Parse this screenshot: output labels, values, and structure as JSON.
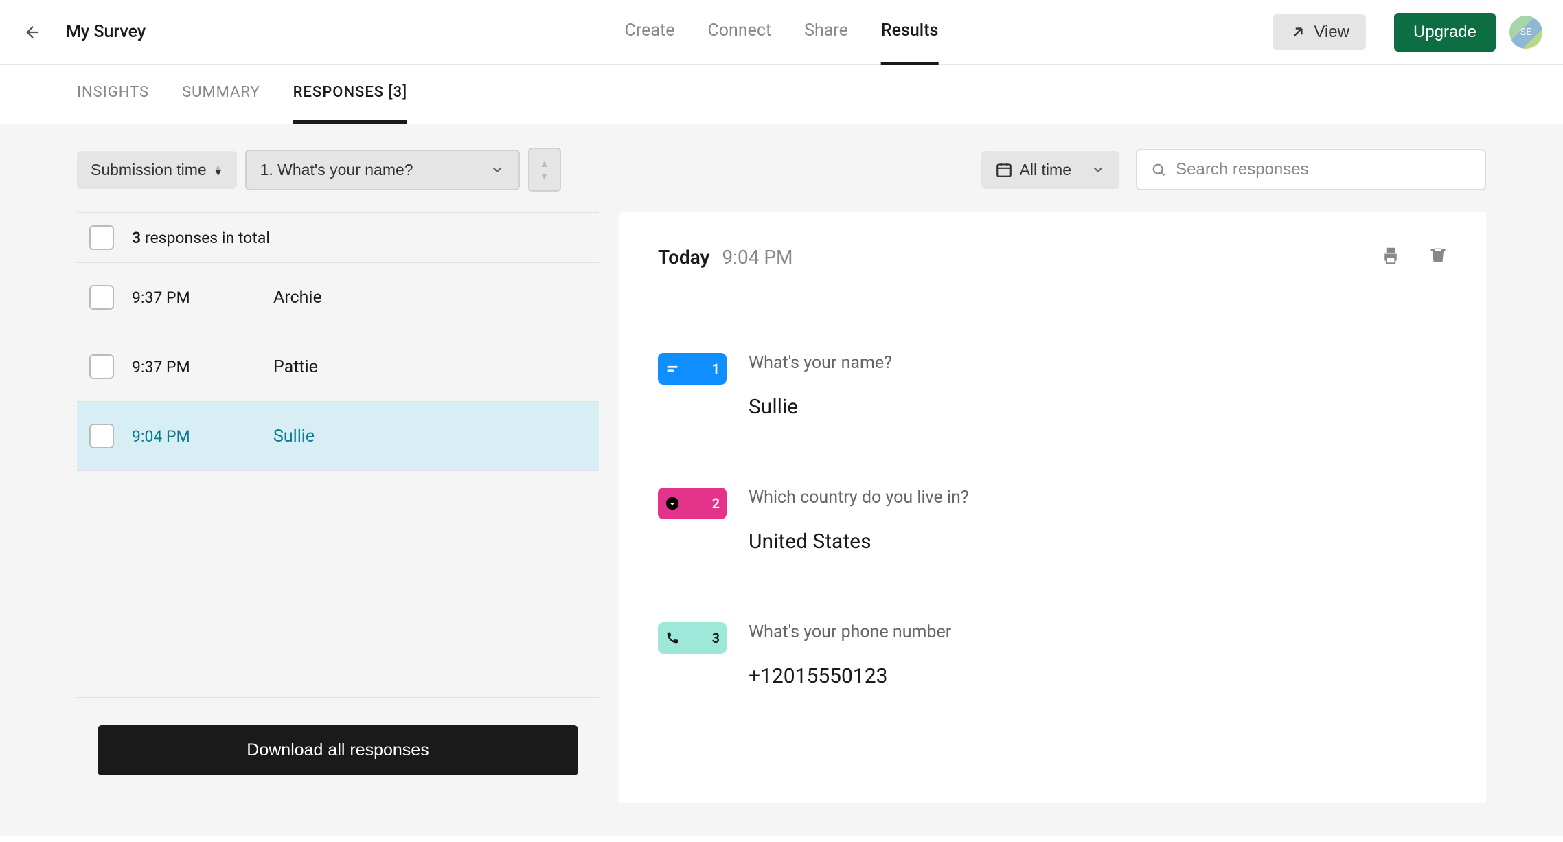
{
  "header": {
    "survey_title": "My Survey",
    "nav": {
      "create": "Create",
      "connect": "Connect",
      "share": "Share",
      "results": "Results"
    },
    "view": "View",
    "upgrade": "Upgrade",
    "avatar": "SE"
  },
  "subnav": {
    "insights": "INSIGHTS",
    "summary": "SUMMARY",
    "responses": "RESPONSES [3]"
  },
  "filters": {
    "sort_by": "Submission time",
    "question": "1. What's your name?",
    "date_range": "All time",
    "search_placeholder": "Search responses"
  },
  "list": {
    "count": "3",
    "count_suffix": "responses in total",
    "rows": [
      {
        "time": "9:37 PM",
        "name": "Archie"
      },
      {
        "time": "9:37 PM",
        "name": "Pattie"
      },
      {
        "time": "9:04 PM",
        "name": "Sullie"
      }
    ],
    "download": "Download all responses"
  },
  "detail": {
    "date": "Today",
    "time": "9:04 PM",
    "items": [
      {
        "num": "1",
        "q": "What's your name?",
        "a": "Sullie"
      },
      {
        "num": "2",
        "q": "Which country do you live in?",
        "a": "United States"
      },
      {
        "num": "3",
        "q": "What's your phone number",
        "a": "+12015550123"
      }
    ]
  }
}
